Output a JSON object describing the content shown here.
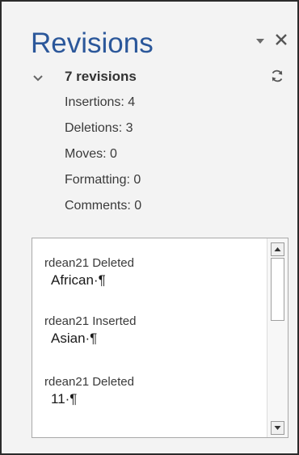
{
  "pane": {
    "title": "Revisions",
    "options_icon": "triangle-down-icon",
    "close_icon": "close-icon"
  },
  "summary": {
    "collapse_icon": "chevron-down-icon",
    "count_label": "7 revisions",
    "refresh_icon": "refresh-icon",
    "stats": [
      "Insertions: 4",
      "Deletions: 3",
      "Moves: 0",
      "Formatting: 0",
      "Comments: 0"
    ]
  },
  "revisions": [
    {
      "meta": "rdean21 Deleted",
      "text": "African·¶"
    },
    {
      "meta": "rdean21 Inserted",
      "text": "Asian·¶"
    },
    {
      "meta": "rdean21 Deleted",
      "text": "11·¶"
    }
  ],
  "colors": {
    "title": "#2b579a",
    "pane_background": "#f3f3f3",
    "list_background": "#ffffff"
  }
}
